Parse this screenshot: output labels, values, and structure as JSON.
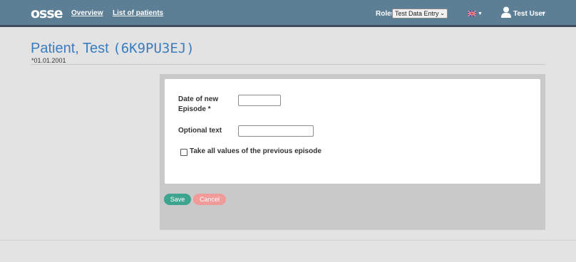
{
  "navbar": {
    "logo_text": "osse",
    "links": [
      {
        "label": "Overview"
      },
      {
        "label": "List of patients"
      }
    ],
    "roles_label": "Roles",
    "roles_selected": "Test Data Entry",
    "language_icon": "uk-flag-icon",
    "user_icon": "user-icon",
    "user_name": "Test User"
  },
  "patient": {
    "name": "Patient, Test",
    "id": "(6K9PU3EJ)",
    "birthdate": "*01.01.2001"
  },
  "form": {
    "date_label_line1": "Date of new",
    "date_label_line2": "Episode *",
    "date_value": "",
    "optional_label": "Optional text",
    "optional_value": "",
    "checkbox_label": "Take all values of the previous episode",
    "checkbox_checked": false
  },
  "buttons": {
    "save": "Save",
    "cancel": "Cancel"
  },
  "colors": {
    "navbar": "#5d7f96",
    "title": "#3a7dbf",
    "save": "#3ea38f",
    "cancel": "#f19a9a"
  }
}
